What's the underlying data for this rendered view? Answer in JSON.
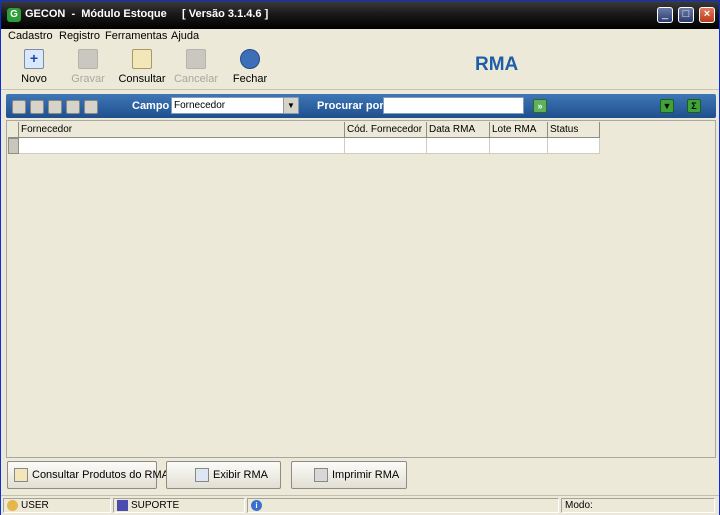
{
  "window": {
    "title": "GECON  -  Módulo Estoque     [ Versão 3.1.4.6 ]",
    "app_icon_letter": "G"
  },
  "menu": [
    {
      "label": "Cadastro"
    },
    {
      "label": "Registro"
    },
    {
      "label": "Ferramentas"
    },
    {
      "label": "Ajuda"
    }
  ],
  "toolbar": {
    "novo": "Novo",
    "gravar": "Gravar",
    "consultar": "Consultar",
    "cancelar": "Cancelar",
    "fechar": "Fechar"
  },
  "page_title": "RMA",
  "search": {
    "campo_label": "Campo",
    "campo_value": "Fornecedor",
    "procurar_label": "Procurar por",
    "procurar_value": ""
  },
  "grid": {
    "columns": [
      "Fornecedor",
      "Cód. Fornecedor",
      "Data RMA",
      "Lote RMA",
      "Status"
    ]
  },
  "buttons": {
    "consultar_produtos": "Consultar Produtos do RMA",
    "exibir": "Exibir RMA",
    "imprimir": "Imprimir RMA"
  },
  "status": {
    "user": "USER",
    "host": "SUPORTE",
    "modo_label": "Modo:",
    "modo_value": ""
  },
  "colors": {
    "accent": "#1d5fa6",
    "search_bar": "#2a5ea0",
    "title_bar": "#1a1a1a"
  }
}
